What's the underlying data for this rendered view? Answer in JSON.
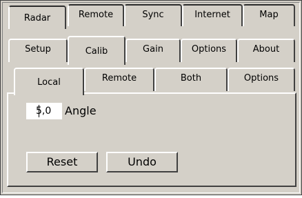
{
  "tabs_row1": [
    {
      "label": "Radar"
    },
    {
      "label": "Remote"
    },
    {
      "label": "Sync"
    },
    {
      "label": "Internet"
    },
    {
      "label": "Map"
    }
  ],
  "tabs_row2": [
    {
      "label": "Setup"
    },
    {
      "label": "Calib"
    },
    {
      "label": "Gain"
    },
    {
      "label": "Options"
    },
    {
      "label": "About"
    }
  ],
  "tabs_row3": [
    {
      "label": "Local"
    },
    {
      "label": "Remote"
    },
    {
      "label": "Both"
    },
    {
      "label": "Options"
    }
  ],
  "selected": {
    "row2": "Calib",
    "row3": "Local"
  },
  "angle": {
    "value": "5,0",
    "label": "Angle"
  },
  "buttons": {
    "reset": "Reset",
    "undo": "Undo"
  },
  "colors": {
    "face": "#d4d0c8",
    "highlight": "#ffffff",
    "shadow": "#404040"
  }
}
